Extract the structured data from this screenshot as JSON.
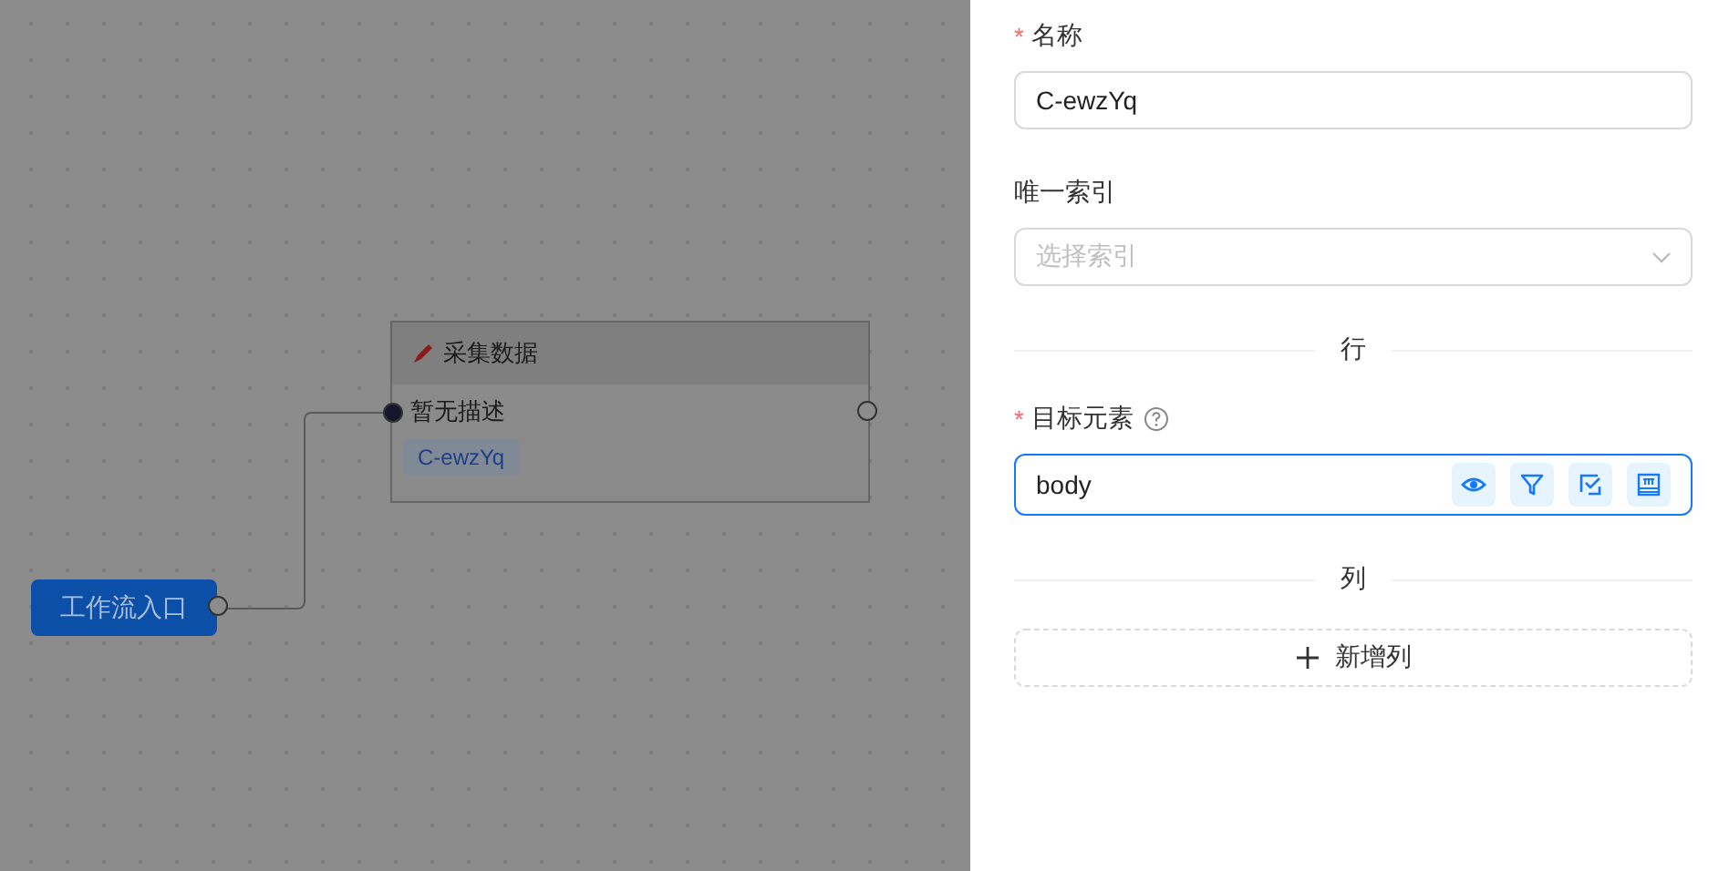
{
  "canvas": {
    "start_node": {
      "label": "工作流入口"
    },
    "node": {
      "title": "采集数据",
      "description": "暂无描述",
      "tag": "C-ewzYq"
    }
  },
  "form": {
    "items": [
      {
        "kind": "input",
        "label": "名称",
        "required_mark": "*",
        "value": "C-ewzYq",
        "focused": false
      },
      {
        "kind": "select",
        "label": "唯一索引",
        "placeholder": "选择索引"
      },
      {
        "kind": "divider",
        "label": "行"
      },
      {
        "kind": "input",
        "label": "目标元素",
        "required_mark": "*",
        "help": true,
        "value": "body",
        "focused": true,
        "tools": [
          {
            "kind": "eye"
          },
          {
            "kind": "filter"
          },
          {
            "kind": "check"
          },
          {
            "kind": "layout"
          }
        ]
      },
      {
        "kind": "divider",
        "label": "列"
      },
      {
        "kind": "add_button",
        "label": "新增列"
      }
    ]
  }
}
